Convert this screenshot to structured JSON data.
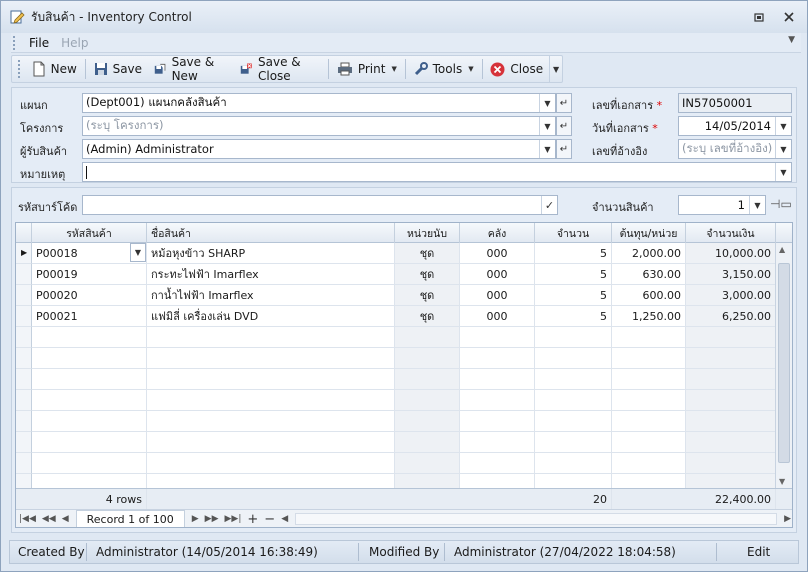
{
  "window": {
    "title": "รับสินค้า - Inventory Control",
    "accent": "#dfe8f3"
  },
  "menu": {
    "file": "File",
    "help": "Help"
  },
  "toolbar": {
    "new": "New",
    "save": "Save",
    "save_new": "Save & New",
    "save_close": "Save & Close",
    "print": "Print",
    "tools": "Tools",
    "close": "Close"
  },
  "form": {
    "dept_label": "แผนก",
    "dept_value": "(Dept001) แผนกคลังสินค้า",
    "project_label": "โครงการ",
    "project_placeholder": "(ระบุ โครงการ)",
    "receiver_label": "ผู้รับสินค้า",
    "receiver_value": "(Admin) Administrator",
    "note_label": "หมายเหตุ",
    "note_value": "",
    "docno_label": "เลขที่เอกสาร",
    "docno_value": "IN57050001",
    "docdate_label": "วันที่เอกสาร",
    "docdate_value": "14/05/2014",
    "ref_label": "เลขที่อ้างอิง",
    "ref_placeholder": "(ระบุ เลขที่อ้างอิง)",
    "required_mark": "*"
  },
  "scan": {
    "barcode_label": "รหัสบาร์โค้ด",
    "barcode_value": "",
    "qty_label": "จำนวนสินค้า",
    "qty_value": "1"
  },
  "grid": {
    "columns": [
      "รหัสสินค้า",
      "ชื่อสินค้า",
      "หน่วยนับ",
      "คลัง",
      "จำนวน",
      "ต้นทุน/หน่วย",
      "จำนวนเงิน"
    ],
    "rows": [
      {
        "code": "P00018",
        "name": "หม้อหุงข้าว SHARP",
        "unit": "ชุด",
        "wh": "000",
        "qty": "5",
        "cost": "2,000.00",
        "amount": "10,000.00"
      },
      {
        "code": "P00019",
        "name": "กระทะไฟฟ้า Imarflex",
        "unit": "ชุด",
        "wh": "000",
        "qty": "5",
        "cost": "630.00",
        "amount": "3,150.00"
      },
      {
        "code": "P00020",
        "name": "กาน้ำไฟฟ้า Imarflex",
        "unit": "ชุด",
        "wh": "000",
        "qty": "5",
        "cost": "600.00",
        "amount": "3,000.00"
      },
      {
        "code": "P00021",
        "name": "แฟมิลี่ เครื่องเล่น DVD",
        "unit": "ชุด",
        "wh": "000",
        "qty": "5",
        "cost": "1,250.00",
        "amount": "6,250.00"
      }
    ],
    "footer": {
      "row_count": "4 rows",
      "total_qty": "20",
      "total_amount": "22,400.00"
    },
    "nav_record": "Record 1 of 100"
  },
  "status": {
    "created_label": "Created By",
    "created_value": "Administrator (14/05/2014 16:38:49)",
    "modified_label": "Modified By",
    "modified_value": "Administrator (27/04/2022 18:04:58)",
    "mode": "Edit"
  }
}
